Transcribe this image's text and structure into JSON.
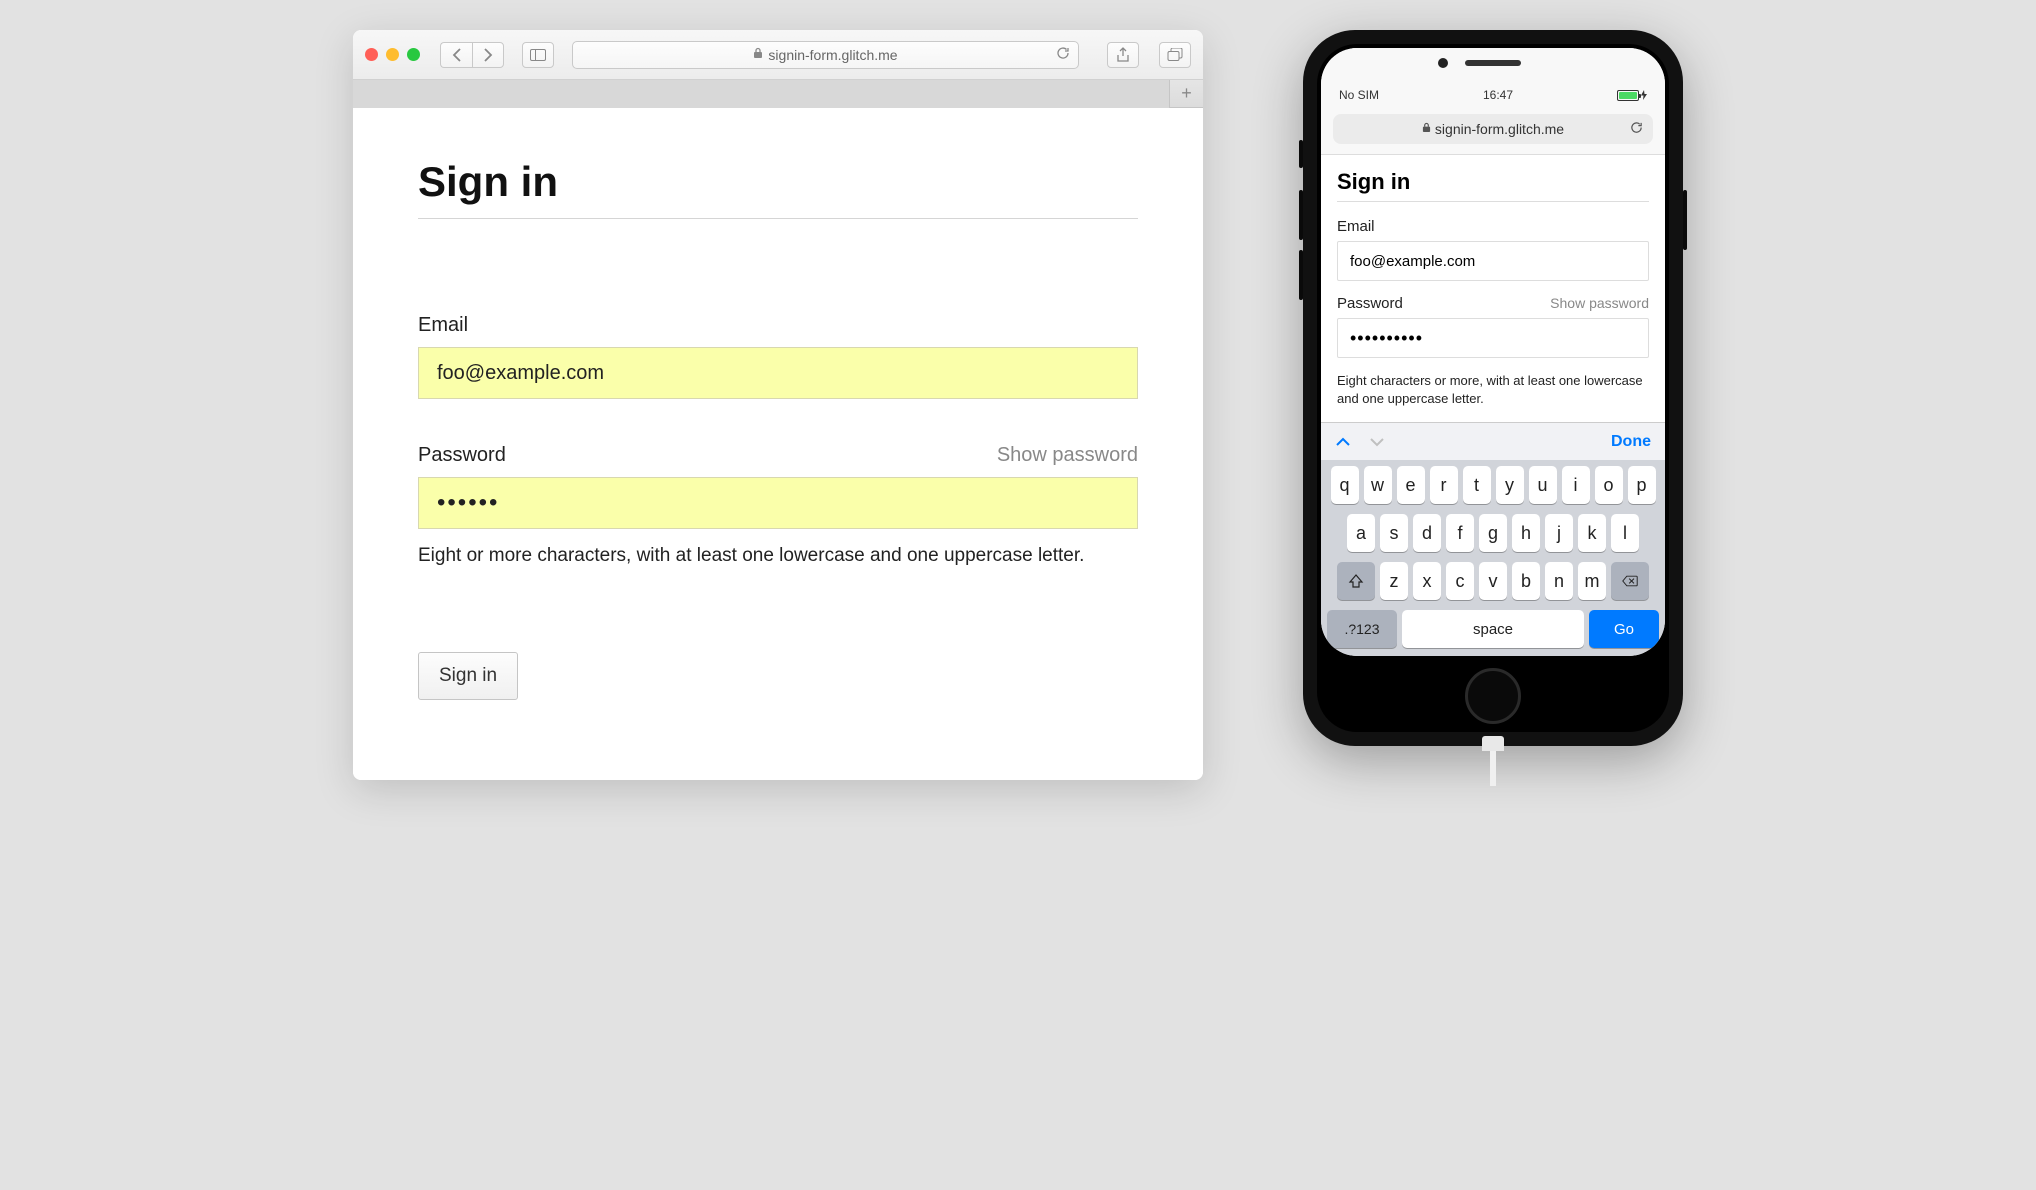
{
  "desktop": {
    "url": "signin-form.glitch.me",
    "page": {
      "title": "Sign in",
      "email_label": "Email",
      "email_value": "foo@example.com",
      "password_label": "Password",
      "show_password": "Show password",
      "password_value": "••••••",
      "helper": "Eight or more characters, with at least one lowercase and one uppercase letter.",
      "submit_label": "Sign in"
    }
  },
  "mobile": {
    "status": {
      "carrier": "No SIM",
      "time": "16:47"
    },
    "url": "signin-form.glitch.me",
    "page": {
      "title": "Sign in",
      "email_label": "Email",
      "email_value": "foo@example.com",
      "password_label": "Password",
      "show_password": "Show password",
      "password_value": "••••••••••",
      "helper": "Eight characters or more, with at least one lowercase and one uppercase letter."
    },
    "keyboard": {
      "done": "Done",
      "row1": [
        "q",
        "w",
        "e",
        "r",
        "t",
        "y",
        "u",
        "i",
        "o",
        "p"
      ],
      "row2": [
        "a",
        "s",
        "d",
        "f",
        "g",
        "h",
        "j",
        "k",
        "l"
      ],
      "row3": [
        "z",
        "x",
        "c",
        "v",
        "b",
        "n",
        "m"
      ],
      "numkey": ".?123",
      "space": "space",
      "go": "Go"
    }
  }
}
